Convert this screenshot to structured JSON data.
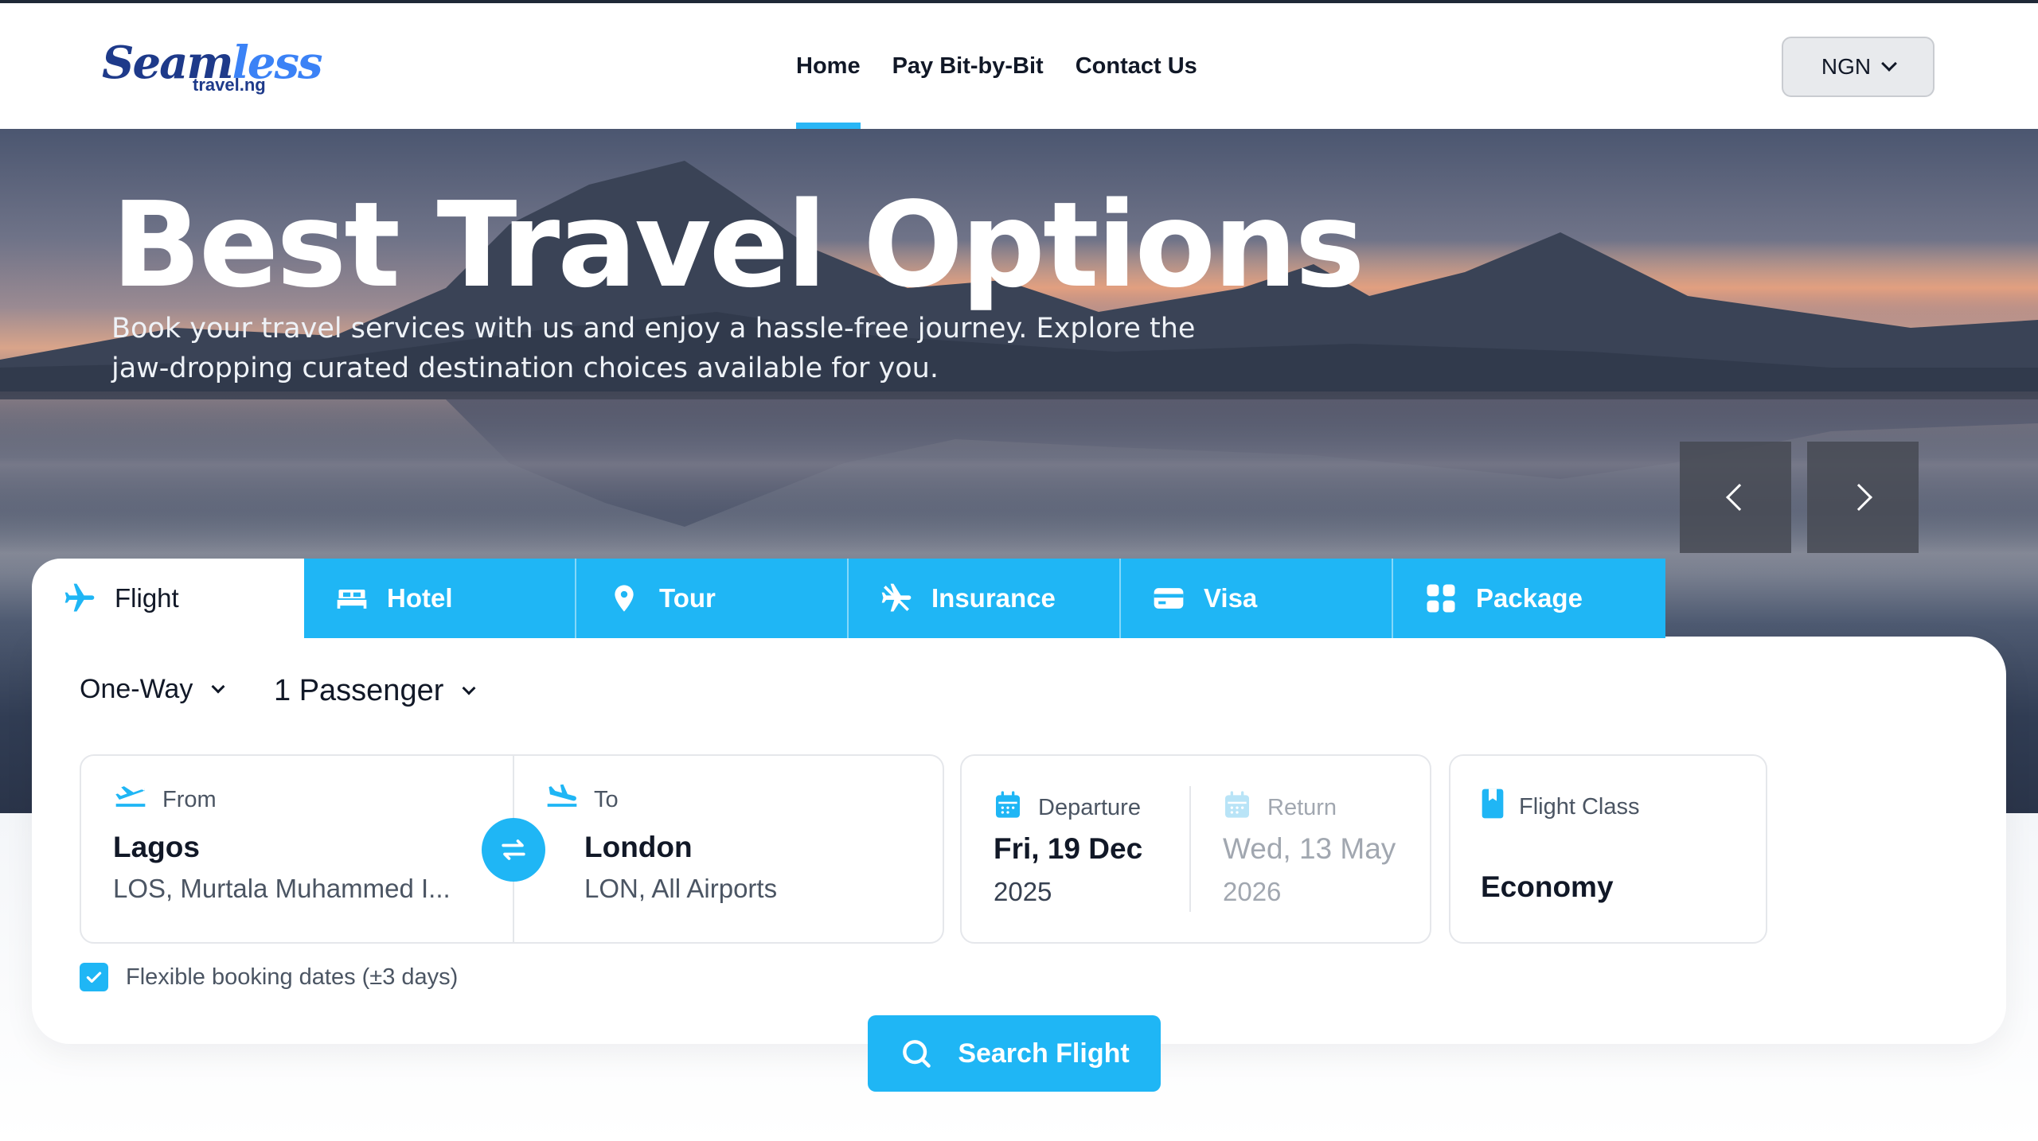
{
  "header": {
    "logo_main": "Seamless",
    "logo_sub": "travel.ng",
    "nav": [
      {
        "label": "Home",
        "active": true
      },
      {
        "label": "Pay Bit-by-Bit",
        "active": false
      },
      {
        "label": "Contact Us",
        "active": false
      }
    ],
    "currency": "NGN"
  },
  "hero": {
    "title": "Best Travel Options",
    "subtitle_line1": "Book your travel services with us and enjoy a hassle-free journey. Explore the",
    "subtitle_line2": "jaw-dropping curated destination choices available for you."
  },
  "tabs": [
    {
      "label": "Flight",
      "icon": "airplane-icon",
      "active": true
    },
    {
      "label": "Hotel",
      "icon": "bed-icon",
      "active": false
    },
    {
      "label": "Tour",
      "icon": "location-pin-icon",
      "active": false
    },
    {
      "label": "Insurance",
      "icon": "plane-shield-icon",
      "active": false
    },
    {
      "label": "Visa",
      "icon": "card-icon",
      "active": false
    },
    {
      "label": "Package",
      "icon": "grid-icon",
      "active": false
    }
  ],
  "search": {
    "trip_type": "One-Way",
    "passengers": "1 Passenger",
    "from": {
      "label": "From",
      "city": "Lagos",
      "detail": "LOS, Murtala Muhammed I..."
    },
    "to": {
      "label": "To",
      "city": "London",
      "detail": "LON, All Airports"
    },
    "departure": {
      "label": "Departure",
      "date": "Fri, 19 Dec",
      "year": "2025"
    },
    "return": {
      "label": "Return",
      "date": "Wed, 13 May",
      "year": "2026"
    },
    "flight_class": {
      "label": "Flight Class",
      "value": "Economy"
    },
    "flexible_dates": "Flexible booking dates (±3 days)",
    "flexible_checked": true,
    "button": "Search Flight"
  },
  "colors": {
    "accent": "#1fb6f5",
    "brand_dark": "#1e3a8a",
    "text": "#111827",
    "muted": "#4b5563"
  }
}
